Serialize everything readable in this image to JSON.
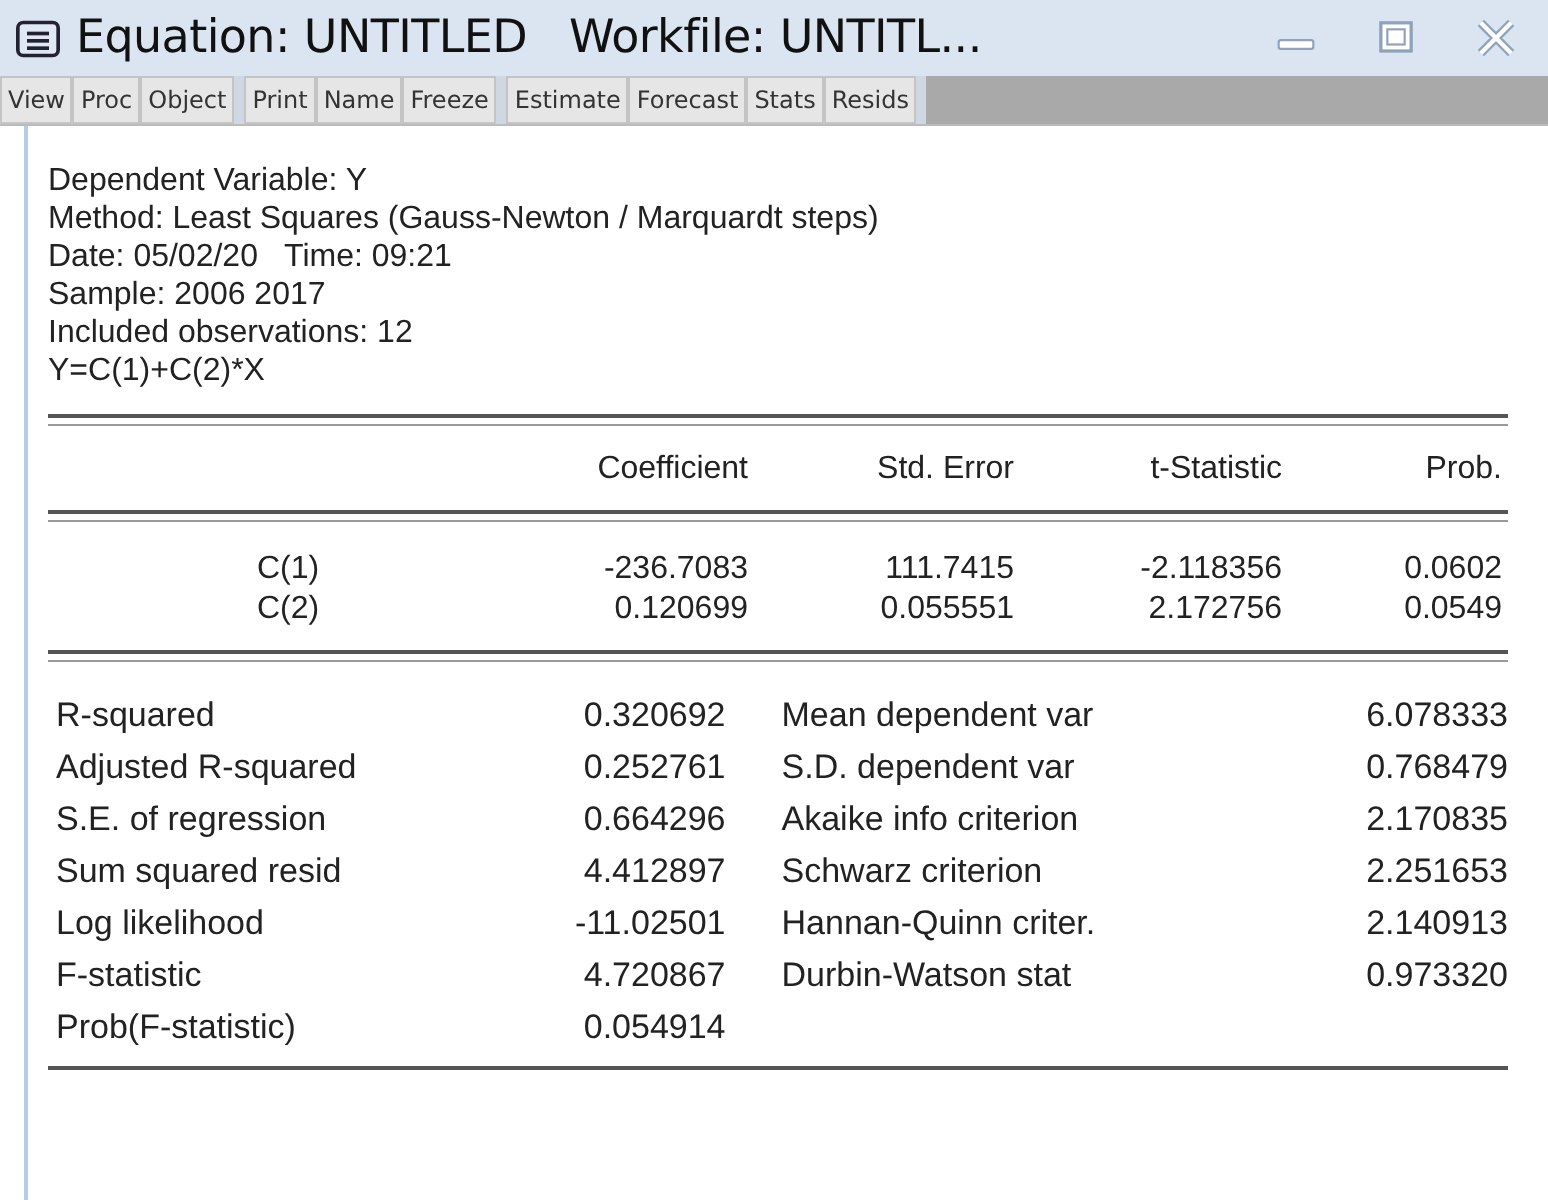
{
  "window": {
    "title": "Equation: UNTITLED   Workfile: UNTITL..."
  },
  "toolbar": {
    "groups": [
      [
        "View",
        "Proc",
        "Object"
      ],
      [
        "Print",
        "Name",
        "Freeze"
      ],
      [
        "Estimate",
        "Forecast",
        "Stats",
        "Resids"
      ]
    ]
  },
  "header_lines": [
    "Dependent Variable: Y",
    "Method: Least Squares (Gauss-Newton / Marquardt steps)",
    "Date: 05/02/20   Time: 09:21",
    "Sample: 2006 2017",
    "Included observations: 12",
    "Y=C(1)+C(2)*X"
  ],
  "coef_table": {
    "columns": [
      "Coefficient",
      "Std. Error",
      "t-Statistic",
      "Prob."
    ],
    "rows": [
      {
        "variable": "C(1)",
        "values": [
          "-236.7083",
          "111.7415",
          "-2.118356",
          "0.0602"
        ]
      },
      {
        "variable": "C(2)",
        "values": [
          "0.120699",
          "0.055551",
          "2.172756",
          "0.0549"
        ]
      }
    ]
  },
  "stats": [
    {
      "label": "R-squared",
      "value": "0.320692",
      "label_2": "Mean dependent var",
      "value_2": "6.078333"
    },
    {
      "label": "Adjusted R-squared",
      "value": "0.252761",
      "label_2": "S.D. dependent var",
      "value_2": "0.768479"
    },
    {
      "label": "S.E. of regression",
      "value": "0.664296",
      "label_2": "Akaike info criterion",
      "value_2": "2.170835"
    },
    {
      "label": "Sum squared resid",
      "value": "4.412897",
      "label_2": "Schwarz criterion",
      "value_2": "2.251653"
    },
    {
      "label": "Log likelihood",
      "value": "-11.02501",
      "label_2": "Hannan-Quinn criter.",
      "value_2": "2.140913"
    },
    {
      "label": "F-statistic",
      "value": "4.720867",
      "label_2": "Durbin-Watson stat",
      "value_2": "0.973320"
    },
    {
      "label": "Prob(F-statistic)",
      "value": "0.054914"
    }
  ]
}
